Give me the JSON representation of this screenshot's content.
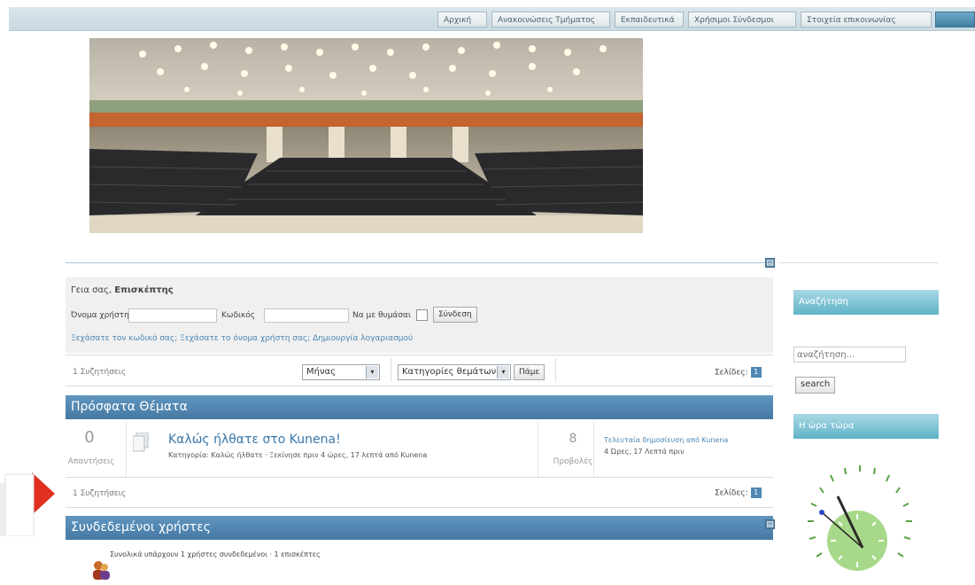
{
  "nav": {
    "items": [
      "Αρχική",
      "Ανακοινώσεις Τμήματος",
      "Εκπαιδευτικά",
      "Χρήσιμοι Σύνδεσμοι",
      "Στοιχεία επικοινωνίας"
    ]
  },
  "login": {
    "welcome_prefix": "Γεια σας,",
    "welcome_user": "Επισκέπτης",
    "username_label": "Όνομα χρήστη",
    "password_label": "Κωδικός",
    "remember_label": "Να με θυμάσαι",
    "login_button": "Σύνδεση",
    "forgot_links": "Ξεχάσατε τον κωδικό σας; Ξεχάσατε το όνομα χρήστη σας; Δημιουργία λογαριασμού"
  },
  "filter": {
    "threads_count": "1 Συζητήσεις",
    "period_select": "Μήνας",
    "category_select": "Κατηγορίες θεμάτων",
    "go_button": "Πάμε",
    "pages_label": "Σελίδες:",
    "page_number": "1"
  },
  "recent": {
    "heading": "Πρόσφατα Θέματα",
    "topic": {
      "replies_count": "0",
      "replies_label": "Απαντήσεις",
      "title": "Καλώς ήλθατε στο Kunena!",
      "meta": "Κατηγορία: Καλώς ήλθατε · Ξεκίνησε πριν 4 ώρες, 17 λεπτά από Kunena",
      "views_count": "8",
      "views_label": "Προβολές",
      "last_post": "Τελευταία δημοσίευση από Kunena",
      "last_post_time": "4 Ώρες, 17 Λεπτά πριν"
    },
    "footer_threads": "1 Συζητήσεις",
    "footer_pages_label": "Σελίδες:",
    "footer_page_number": "1"
  },
  "online": {
    "heading": "Συνδεδεμένοι χρήστες",
    "text": "Συνολικά υπάρχουν 1 χρήστες συνδεδεμένοι · 1 επισκέπτες"
  },
  "sidebar": {
    "search_heading": "Αναζήτηση",
    "search_placeholder": "αναζήτηση...",
    "search_button": "search",
    "clock_heading": "Η ώρα τώρα"
  },
  "colors": {
    "section_header": "#467aa3",
    "sidebar_header": "#5fb3c8",
    "nav_bg": "#d9e6ec"
  }
}
